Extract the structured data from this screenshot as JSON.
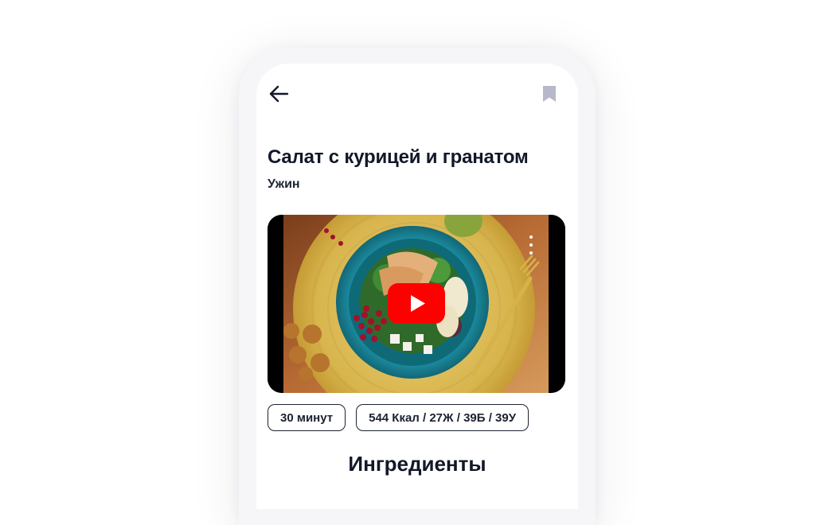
{
  "recipe": {
    "title": "Салат с курицей и гранатом",
    "meal_type": "Ужин"
  },
  "video": {
    "thumbnail": "chicken-pomegranate-salad-photo",
    "play_icon": "youtube-play-icon",
    "menu_icon": "more-vertical-icon"
  },
  "info_chips": [
    {
      "label": "30 минут"
    },
    {
      "label": "544 Ккал / 27Ж / 39Б / 39У"
    }
  ],
  "sections": {
    "ingredients_title": "Ингредиенты"
  },
  "colors": {
    "text_primary": "#111827",
    "bookmark_icon": "#b8b9c8",
    "youtube_red": "#ff0000",
    "phone_frame": "#f6f6f8"
  }
}
